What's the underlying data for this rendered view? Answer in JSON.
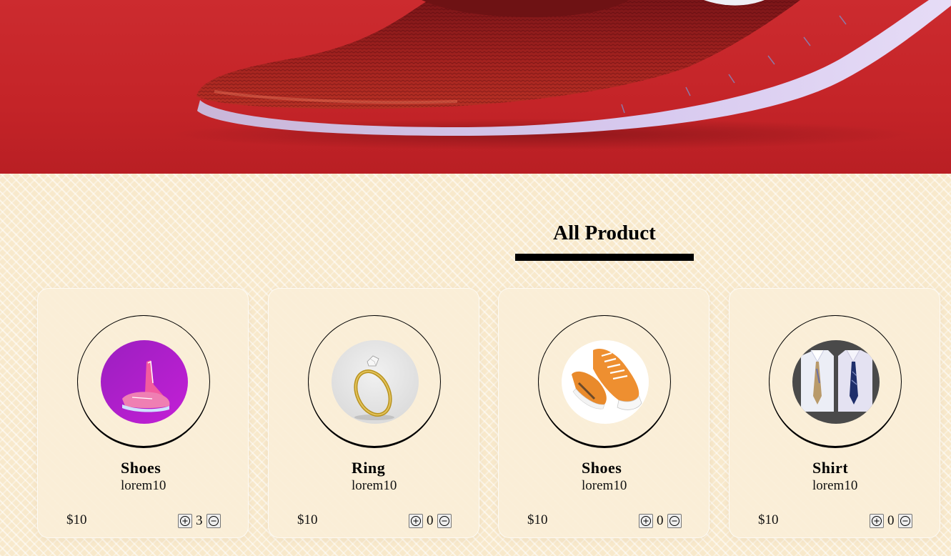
{
  "page": {
    "section_title": "All Product"
  },
  "colors": {
    "hero_red": "#c42428",
    "shoe_knit": "#9e1f22",
    "sole": "#cdbfe6",
    "title_underline": "#000000",
    "page_background": "#f8e9cc"
  },
  "icons": {
    "increase": "plus-circle-icon",
    "decrease": "minus-circle-icon"
  },
  "products": [
    {
      "name": "Shoes",
      "description": "lorem10",
      "price": "$10",
      "quantity": "3",
      "image": "pink-flying-sneakers-on-purple"
    },
    {
      "name": "Ring",
      "description": "lorem10",
      "price": "$10",
      "quantity": "0",
      "image": "gold-diamond-ring-on-grey"
    },
    {
      "name": "Shoes",
      "description": "lorem10",
      "price": "$10",
      "quantity": "0",
      "image": "orange-canvas-sneakers-on-white"
    },
    {
      "name": "Shirt",
      "description": "lorem10",
      "price": "$10",
      "quantity": "0",
      "image": "folded-shirts-with-ties-on-dark"
    }
  ]
}
